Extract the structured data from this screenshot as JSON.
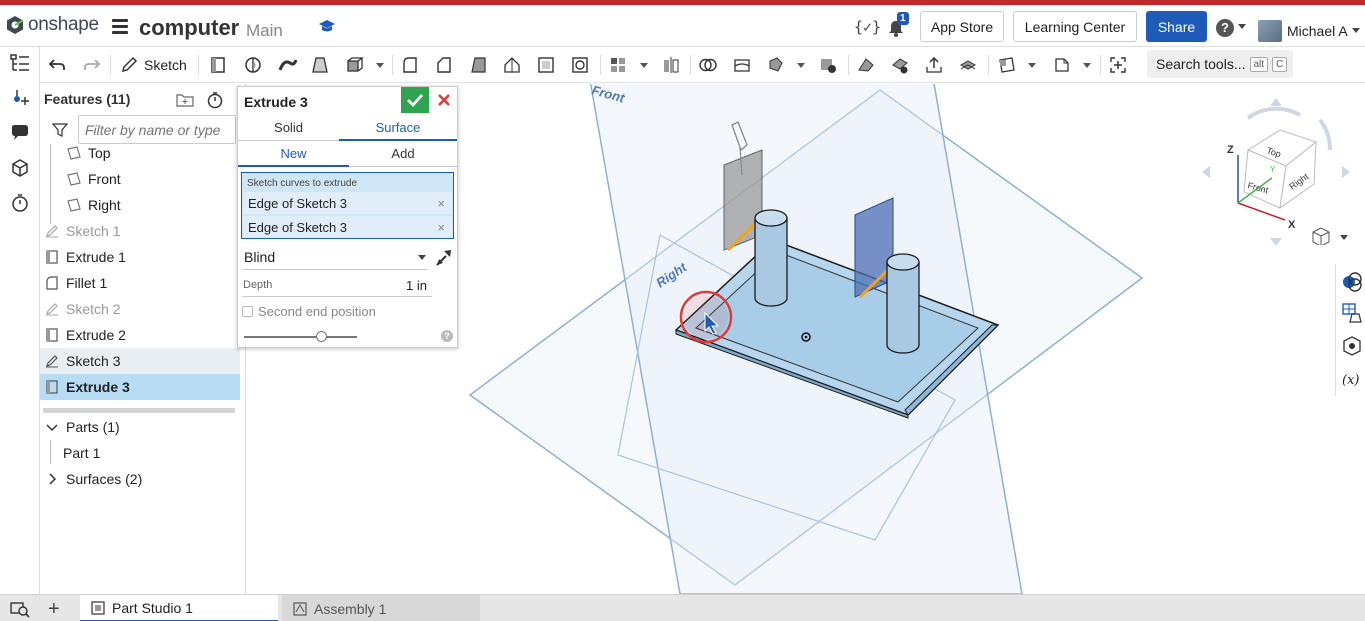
{
  "app": {
    "logo_text": "onshape",
    "document_title": "computer",
    "branch": "Main"
  },
  "header": {
    "notification_count": "1",
    "app_store": "App Store",
    "learning_center": "Learning Center",
    "share": "Share",
    "help": "?",
    "user_name": "Michael A"
  },
  "toolbar": {
    "sketch_label": "Sketch",
    "search_tools": "Search tools...",
    "search_shortcut_1": "alt",
    "search_shortcut_2": "C"
  },
  "features": {
    "header": "Features (11)",
    "filter_placeholder": "Filter by name or type",
    "items": [
      {
        "label": "Top"
      },
      {
        "label": "Front"
      },
      {
        "label": "Right"
      },
      {
        "label": "Sketch 1"
      },
      {
        "label": "Extrude 1"
      },
      {
        "label": "Fillet 1"
      },
      {
        "label": "Sketch 2"
      },
      {
        "label": "Extrude 2"
      },
      {
        "label": "Sketch 3"
      },
      {
        "label": "Extrude 3"
      }
    ],
    "parts_header": "Parts (1)",
    "part_1": "Part 1",
    "surfaces_header": "Surfaces (2)"
  },
  "dialog": {
    "title": "Extrude 3",
    "tab_solid": "Solid",
    "tab_surface": "Surface",
    "sub_new": "New",
    "sub_add": "Add",
    "selection_label": "Sketch curves to extrude",
    "selection_items": [
      "Edge of Sketch 3",
      "Edge of Sketch 3"
    ],
    "end_type": "Blind",
    "depth_label": "Depth",
    "depth_value": "1 in",
    "second_end": "Second end position",
    "help": "?"
  },
  "viewport": {
    "plane_front": "Front",
    "plane_right": "Right",
    "cube_top": "Top",
    "cube_front": "Front",
    "cube_right": "Right",
    "axis_x": "X",
    "axis_y": "Y",
    "axis_z": "Z"
  },
  "tabs": [
    {
      "label": "Part Studio 1"
    },
    {
      "label": "Assembly 1"
    }
  ],
  "colors": {
    "brand_red": "#c0282b",
    "accent_blue": "#1e5bb8",
    "selection_blue": "#b8dcf4",
    "ok_green": "#2ea44f"
  }
}
